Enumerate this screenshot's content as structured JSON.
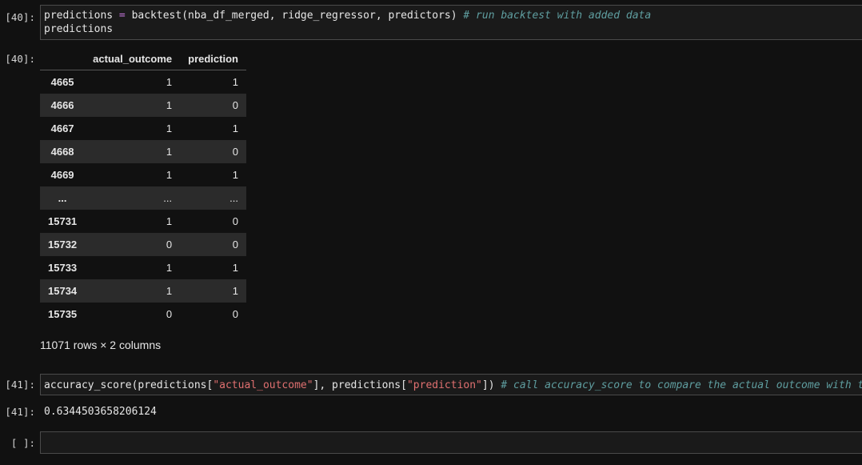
{
  "cells": {
    "c40_in_prompt": "[40]:",
    "c40_out_prompt": "[40]:",
    "c41_in_prompt": "[41]:",
    "c41_out_prompt": "[41]:",
    "empty_prompt": "[ ]:"
  },
  "code40": {
    "line1_a": "predictions ",
    "line1_op": "=",
    "line1_b": " backtest(nba_df_merged, ridge_regressor, predictors) ",
    "line1_comment": "# run backtest with added data",
    "line2": "predictions"
  },
  "table": {
    "columns": [
      "actual_outcome",
      "prediction"
    ],
    "rows": [
      {
        "index": "4665",
        "actual_outcome": "1",
        "prediction": "1"
      },
      {
        "index": "4666",
        "actual_outcome": "1",
        "prediction": "0"
      },
      {
        "index": "4667",
        "actual_outcome": "1",
        "prediction": "1"
      },
      {
        "index": "4668",
        "actual_outcome": "1",
        "prediction": "0"
      },
      {
        "index": "4669",
        "actual_outcome": "1",
        "prediction": "1"
      },
      {
        "index": "...",
        "actual_outcome": "...",
        "prediction": "..."
      },
      {
        "index": "15731",
        "actual_outcome": "1",
        "prediction": "0"
      },
      {
        "index": "15732",
        "actual_outcome": "0",
        "prediction": "0"
      },
      {
        "index": "15733",
        "actual_outcome": "1",
        "prediction": "1"
      },
      {
        "index": "15734",
        "actual_outcome": "1",
        "prediction": "1"
      },
      {
        "index": "15735",
        "actual_outcome": "0",
        "prediction": "0"
      }
    ],
    "summary": "11071 rows × 2 columns"
  },
  "code41": {
    "fn": "accuracy_score(predictions[",
    "str1": "\"actual_outcome\"",
    "mid": "], predictions[",
    "str2": "\"prediction\"",
    "end": "]) ",
    "comment": "# call accuracy_score to compare the actual outcome with t"
  },
  "output41": "0.6344503658206124"
}
